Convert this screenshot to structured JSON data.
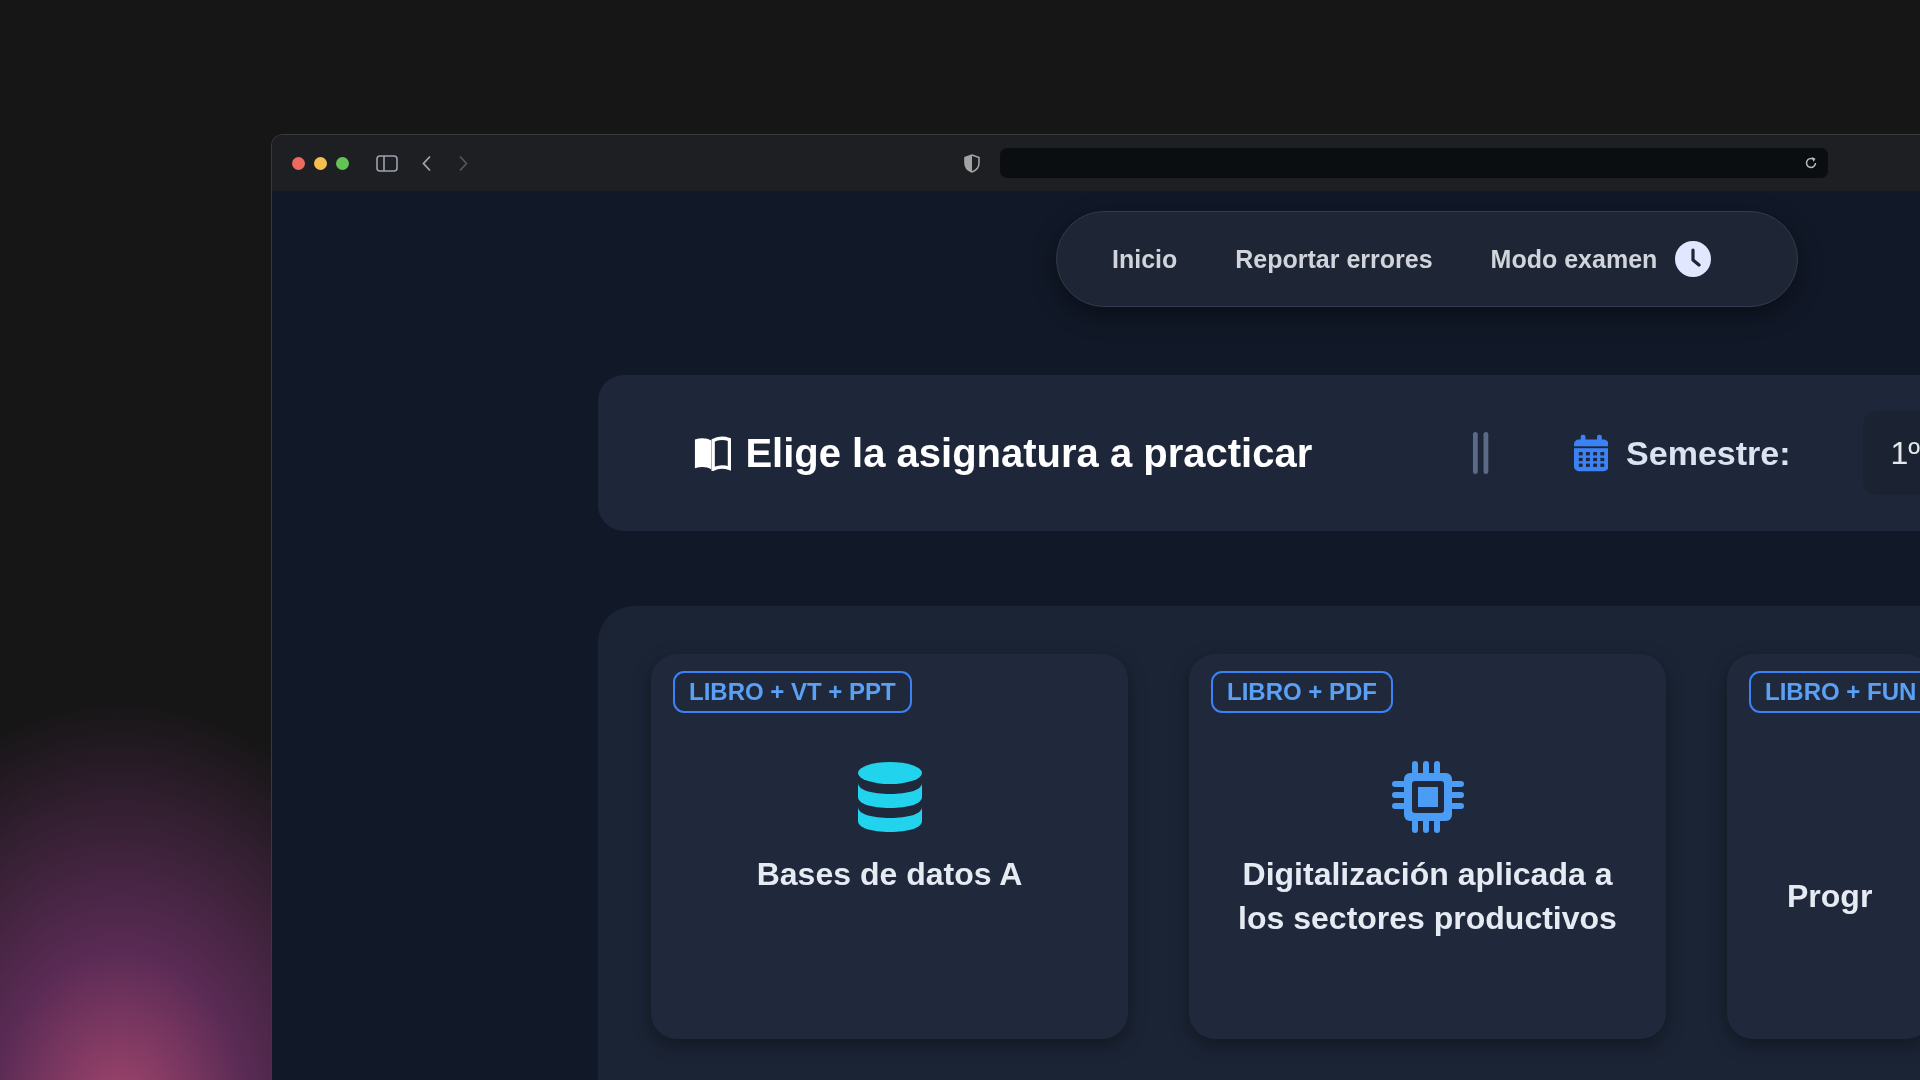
{
  "nav": {
    "items": [
      {
        "label": "Inicio",
        "kind": "link"
      },
      {
        "label": "Reportar errores",
        "kind": "link"
      },
      {
        "label": "Modo examen",
        "kind": "timer"
      }
    ]
  },
  "header": {
    "title": "Elige la asignatura a practicar",
    "semester_label": "Semestre:",
    "semester_value": "1º"
  },
  "subjects": [
    {
      "badge": "LIBRO + VT + PPT",
      "kind": "database",
      "title": "Bases de datos A"
    },
    {
      "badge": "LIBRO + PDF",
      "kind": "chip",
      "title": "Digitalización aplicada a los sectores productivos"
    },
    {
      "badge": "LIBRO + FUN",
      "kind": "plain",
      "title": "Progr"
    }
  ]
}
